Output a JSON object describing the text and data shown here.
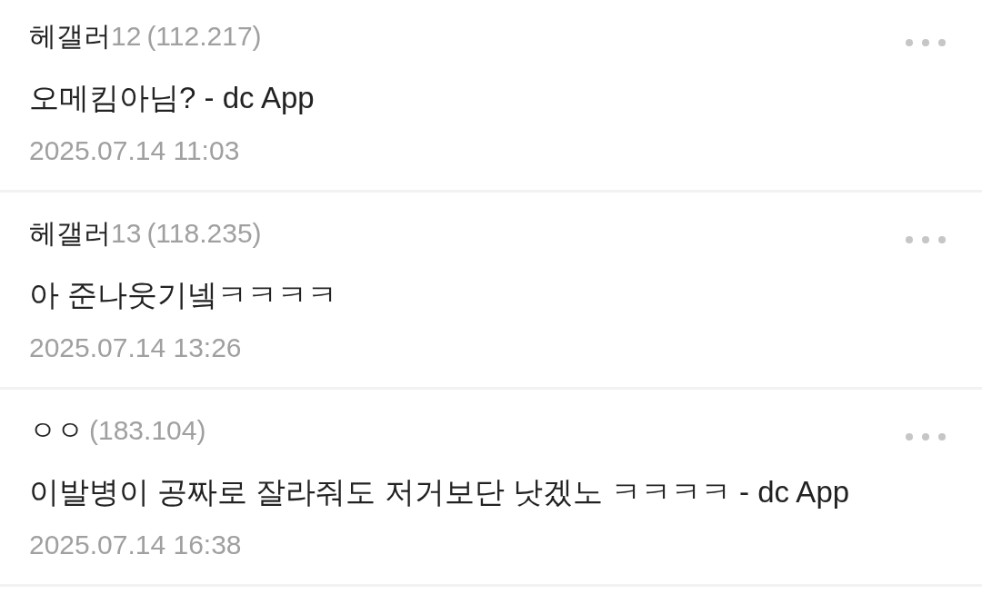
{
  "comments": [
    {
      "author": "헤갤러",
      "author_number": "12",
      "ip": "(112.217)",
      "text": "오메킴아님? - dc App",
      "date": "2025.07.14 11:03"
    },
    {
      "author": "헤갤러",
      "author_number": "13",
      "ip": "(118.235)",
      "text": "아 준나웃기넼ㅋㅋㅋㅋ",
      "date": "2025.07.14 13:26"
    },
    {
      "author": "ㅇㅇ",
      "ip": "(183.104)",
      "text": "이발병이 공짜로 잘라줘도 저거보단 낫겠노 ㅋㅋㅋㅋ - dc App",
      "date": "2025.07.14 16:38"
    }
  ]
}
